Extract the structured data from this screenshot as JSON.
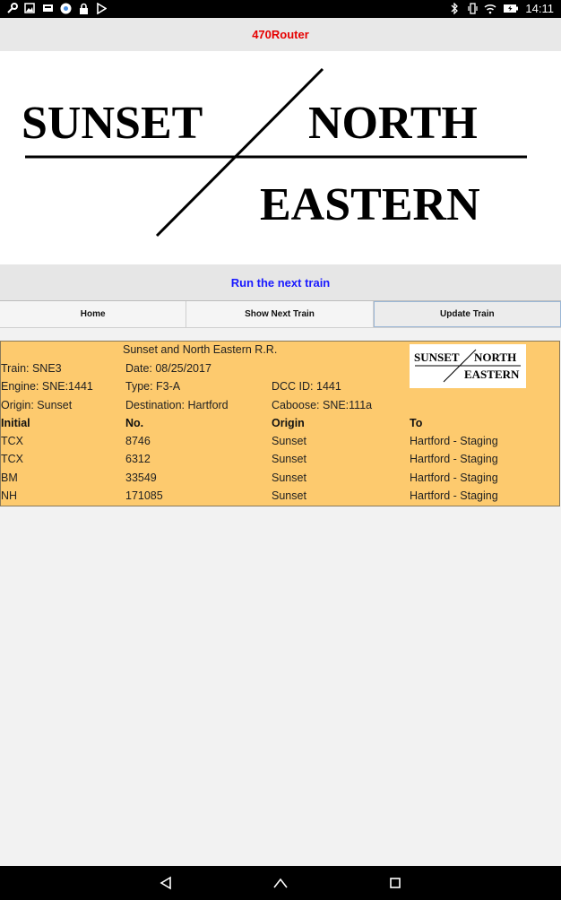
{
  "status_bar": {
    "time": "14:11",
    "left_icons": [
      "wrench-icon",
      "image-icon",
      "tray-icon",
      "chrome-icon",
      "lock-icon",
      "play-store-icon"
    ],
    "right_icons": [
      "bluetooth-icon",
      "vibrate-icon",
      "wifi-icon",
      "battery-icon"
    ]
  },
  "app": {
    "title": "470Router",
    "title_color": "#e60000"
  },
  "banner": {
    "logo_line1_left": "SUNSET",
    "logo_line1_right": "NORTH",
    "logo_line2": "EASTERN"
  },
  "run_next_label": "Run the next train",
  "nav": {
    "home": "Home",
    "show_next": "Show Next Train",
    "update": "Update Train"
  },
  "train_card": {
    "railroad": "Sunset and North Eastern R.R.",
    "train": "Train: SNE3",
    "date": "Date: 08/25/2017",
    "engine": "Engine: SNE:1441",
    "type": "Type: F3-A",
    "dcc": "DCC ID: 1441",
    "origin": "Origin: Sunset",
    "destination": "Destination: Hartford",
    "caboose": "Caboose: SNE:111a",
    "mini_logo": {
      "line1_left": "SUNSET",
      "line1_right": "NORTH",
      "line2": "EASTERN"
    },
    "headers": [
      "Initial",
      "No.",
      "Origin",
      "To"
    ],
    "rows": [
      [
        "TCX",
        "8746",
        "Sunset",
        "Hartford - Staging"
      ],
      [
        "TCX",
        "6312",
        "Sunset",
        "Hartford - Staging"
      ],
      [
        "BM",
        "33549",
        "Sunset",
        "Hartford - Staging"
      ],
      [
        "NH",
        "171085",
        "Sunset",
        "Hartford - Staging"
      ]
    ],
    "background": "#fdca6e"
  }
}
